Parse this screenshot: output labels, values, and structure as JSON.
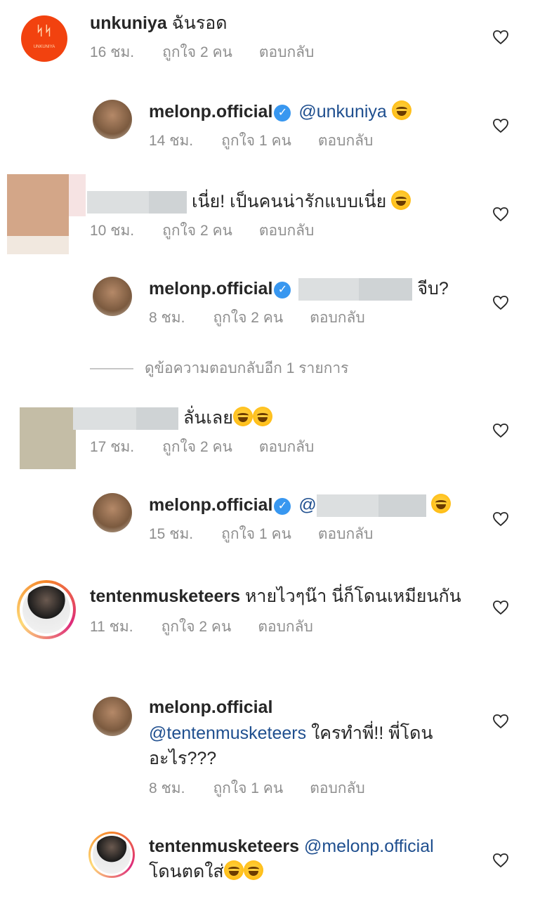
{
  "comments": [
    {
      "user": "unkuniya",
      "text": "ฉันรอด",
      "time": "16 ชม.",
      "likes": "ถูกใจ 2 คน",
      "reply": "ตอบกลับ"
    },
    {
      "user": "melonp.official",
      "mention": "@unkuniya",
      "time": "14 ชม.",
      "likes": "ถูกใจ 1 คน",
      "reply": "ตอบกลับ"
    },
    {
      "text": "เนี่ย! เป็นคนน่ารักแบบเนี่ย",
      "time": "10 ชม.",
      "likes": "ถูกใจ 2 คน",
      "reply": "ตอบกลับ"
    },
    {
      "user": "melonp.official",
      "text": "จีบ?",
      "time": "8 ชม.",
      "likes": "ถูกใจ 2 คน",
      "reply": "ตอบกลับ"
    },
    {
      "text": "ลั่นเลย",
      "time": "17 ชม.",
      "likes": "ถูกใจ 2 คน",
      "reply": "ตอบกลับ"
    },
    {
      "user": "melonp.official",
      "mention_prefix": "@",
      "time": "15 ชม.",
      "likes": "ถูกใจ 1 คน",
      "reply": "ตอบกลับ"
    },
    {
      "user": "tentenmusketeers",
      "text": "หายไวๆน๊า นี่ก็โดนเหมียนกัน",
      "time": "11 ชม.",
      "likes": "ถูกใจ 2 คน",
      "reply": "ตอบกลับ"
    },
    {
      "user": "melonp.official",
      "mention": "@tentenmusketeers",
      "text": "ใครทำพี่!! พี่โดนอะไร???",
      "time": "8 ชม.",
      "likes": "ถูกใจ 1 คน",
      "reply": "ตอบกลับ"
    },
    {
      "user": "tentenmusketeers",
      "mention": "@melonp.official",
      "text": "โดนตดใส่"
    }
  ],
  "view_more": "ดูข้อความตอบกลับอีก 1 รายการ",
  "logo": {
    "top": "ᛋᛋ",
    "bottom": "UNKUNIYA"
  },
  "verified_mark": "✓"
}
